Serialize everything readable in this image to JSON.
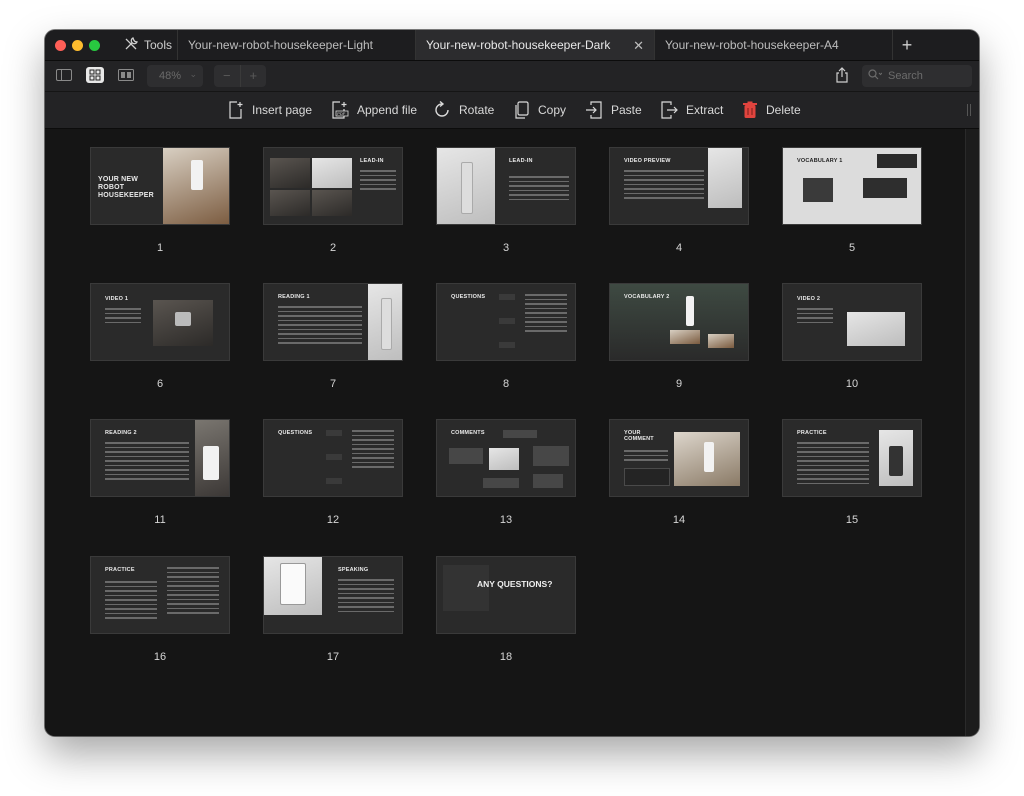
{
  "window": {
    "tools_label": "Tools",
    "tabs": [
      {
        "label": "Your-new-robot-housekeeper-Light",
        "active": false
      },
      {
        "label": "Your-new-robot-housekeeper-Dark",
        "active": true
      },
      {
        "label": "Your-new-robot-housekeeper-A4",
        "active": false
      }
    ],
    "close_glyph": "✕",
    "new_tab_glyph": "+"
  },
  "toolbar": {
    "zoom_value": "48%",
    "zoom_out": "−",
    "zoom_in": "+",
    "search_placeholder": "Search"
  },
  "actions": {
    "insert_page": "Insert page",
    "append_file": "Append file",
    "rotate": "Rotate",
    "copy": "Copy",
    "paste": "Paste",
    "extract": "Extract",
    "delete": "Delete"
  },
  "pages": [
    {
      "number": "1",
      "title": "YOUR NEW ROBOT HOUSEKEEPER"
    },
    {
      "number": "2",
      "title": "LEAD-IN"
    },
    {
      "number": "3",
      "title": "LEAD-IN"
    },
    {
      "number": "4",
      "title": "VIDEO PREVIEW"
    },
    {
      "number": "5",
      "title": "VOCABULARY 1"
    },
    {
      "number": "6",
      "title": "VIDEO 1"
    },
    {
      "number": "7",
      "title": "READING 1"
    },
    {
      "number": "8",
      "title": "QUESTIONS"
    },
    {
      "number": "9",
      "title": "VOCABULARY 2"
    },
    {
      "number": "10",
      "title": "VIDEO 2"
    },
    {
      "number": "11",
      "title": "READING 2"
    },
    {
      "number": "12",
      "title": "QUESTIONS"
    },
    {
      "number": "13",
      "title": "COMMENTS"
    },
    {
      "number": "14",
      "title": "YOUR COMMENT"
    },
    {
      "number": "15",
      "title": "PRACTICE"
    },
    {
      "number": "16",
      "title": "PRACTICE"
    },
    {
      "number": "17",
      "title": "SPEAKING"
    },
    {
      "number": "18",
      "title": "ANY QUESTIONS?"
    }
  ],
  "colors": {
    "window_bg": "#151515",
    "toolbar_bg": "#232325",
    "active_tab_bg": "#2c2c2e",
    "delete_icon": "#e0443e"
  }
}
